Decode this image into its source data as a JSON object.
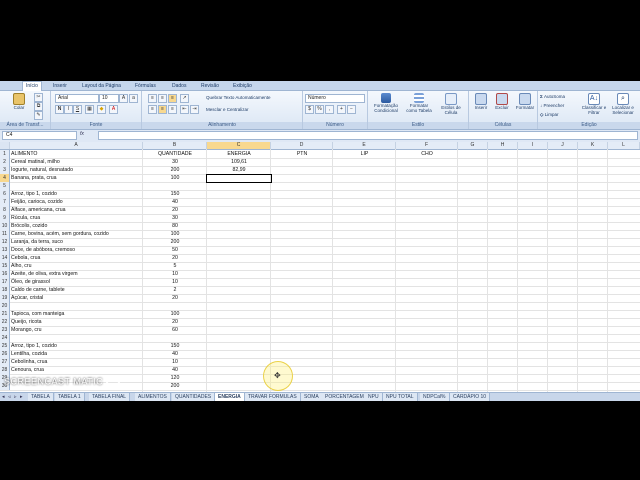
{
  "ribbon_tabs": [
    "Início",
    "Inserir",
    "Layout da Página",
    "Fórmulas",
    "Dados",
    "Revisão",
    "Exibição"
  ],
  "ribbon": {
    "paste_label": "Colar",
    "font_name": "Arial",
    "font_size": "10",
    "wrap_text": "Quebrar Texto Automaticamente",
    "merge_center": "Mesclar e Centralizar",
    "number_format": "Número",
    "cond_format": "Formatação Condicional",
    "format_table": "Formatar como Tabela",
    "cell_styles": "Estilos de Célula",
    "insert": "Inserir",
    "delete": "Excluir",
    "format": "Formatar",
    "autosum": "AutoSoma",
    "fill": "Preencher",
    "clear": "Limpar",
    "sort_filter": "Classificar e Filtrar",
    "find_select": "Localizar e Selecionar",
    "groups": [
      "Área de Transf...",
      "Fonte",
      "Alinhamento",
      "Número",
      "Estilo",
      "Células",
      "Edição"
    ]
  },
  "formula_bar": {
    "name_box": "C4",
    "fx": "fx",
    "content": ""
  },
  "columns": [
    "A",
    "B",
    "C",
    "D",
    "E",
    "F",
    "G",
    "H",
    "I",
    "J",
    "K",
    "L"
  ],
  "rows": [
    {
      "n": "1",
      "a": "ALIMENTO",
      "b": "QUANTIDADE",
      "c": "ENERGIA",
      "d": "PTN",
      "e": "LIP",
      "f": "CHO"
    },
    {
      "n": "2",
      "a": "Cereal matinal, milho",
      "b": "30",
      "c": "109,61",
      "d": "",
      "e": "",
      "f": ""
    },
    {
      "n": "3",
      "a": "Iogurte, natural, desnatado",
      "b": "200",
      "c": "82,99",
      "d": "",
      "e": "",
      "f": ""
    },
    {
      "n": "4",
      "a": "Banana, prata, crua",
      "b": "100",
      "c": "",
      "d": "",
      "e": "",
      "f": ""
    },
    {
      "n": "5",
      "a": "",
      "b": "",
      "c": "",
      "d": "",
      "e": "",
      "f": ""
    },
    {
      "n": "6",
      "a": "Arroz, tipo 1, cozido",
      "b": "150",
      "c": "",
      "d": "",
      "e": "",
      "f": ""
    },
    {
      "n": "7",
      "a": "Feijão, carioca, cozido",
      "b": "40",
      "c": "",
      "d": "",
      "e": "",
      "f": ""
    },
    {
      "n": "8",
      "a": "Alface, americana, crua",
      "b": "20",
      "c": "",
      "d": "",
      "e": "",
      "f": ""
    },
    {
      "n": "9",
      "a": "Rúcula, crua",
      "b": "30",
      "c": "",
      "d": "",
      "e": "",
      "f": ""
    },
    {
      "n": "10",
      "a": "Brócolis, cozido",
      "b": "80",
      "c": "",
      "d": "",
      "e": "",
      "f": ""
    },
    {
      "n": "11",
      "a": "Carne, bovina, acém, sem gordura, cozido",
      "b": "100",
      "c": "",
      "d": "",
      "e": "",
      "f": ""
    },
    {
      "n": "12",
      "a": "Laranja, da terra, suco",
      "b": "200",
      "c": "",
      "d": "",
      "e": "",
      "f": ""
    },
    {
      "n": "13",
      "a": "Doce, de abóbora, cremoso",
      "b": "50",
      "c": "",
      "d": "",
      "e": "",
      "f": ""
    },
    {
      "n": "14",
      "a": "Cebola, crua",
      "b": "20",
      "c": "",
      "d": "",
      "e": "",
      "f": ""
    },
    {
      "n": "15",
      "a": "Alho, cru",
      "b": "5",
      "c": "",
      "d": "",
      "e": "",
      "f": ""
    },
    {
      "n": "16",
      "a": "Azeite, de oliva, extra virgem",
      "b": "10",
      "c": "",
      "d": "",
      "e": "",
      "f": ""
    },
    {
      "n": "17",
      "a": "Óleo, de girassol",
      "b": "10",
      "c": "",
      "d": "",
      "e": "",
      "f": ""
    },
    {
      "n": "18",
      "a": "Caldo de carne, tablete",
      "b": "2",
      "c": "",
      "d": "",
      "e": "",
      "f": ""
    },
    {
      "n": "19",
      "a": "Açúcar, cristal",
      "b": "20",
      "c": "",
      "d": "",
      "e": "",
      "f": ""
    },
    {
      "n": "20",
      "a": "",
      "b": "",
      "c": "",
      "d": "",
      "e": "",
      "f": ""
    },
    {
      "n": "21",
      "a": "Tapioca, com manteiga",
      "b": "100",
      "c": "",
      "d": "",
      "e": "",
      "f": ""
    },
    {
      "n": "22",
      "a": "Queijo, ricota",
      "b": "20",
      "c": "",
      "d": "",
      "e": "",
      "f": ""
    },
    {
      "n": "23",
      "a": "Morango, cru",
      "b": "60",
      "c": "",
      "d": "",
      "e": "",
      "f": ""
    },
    {
      "n": "24",
      "a": "",
      "b": "",
      "c": "",
      "d": "",
      "e": "",
      "f": ""
    },
    {
      "n": "25",
      "a": "Arroz, tipo 1, cozido",
      "b": "150",
      "c": "",
      "d": "",
      "e": "",
      "f": ""
    },
    {
      "n": "26",
      "a": "Lentilha, cozida",
      "b": "40",
      "c": "",
      "d": "",
      "e": "",
      "f": ""
    },
    {
      "n": "27",
      "a": "Cebolinha, crua",
      "b": "10",
      "c": "",
      "d": "",
      "e": "",
      "f": ""
    },
    {
      "n": "28",
      "a": "Cenoura, crua",
      "b": "40",
      "c": "",
      "d": "",
      "e": "",
      "f": ""
    },
    {
      "n": "29",
      "a": "",
      "b": "120",
      "c": "",
      "d": "",
      "e": "",
      "f": ""
    },
    {
      "n": "30",
      "a": "",
      "b": "200",
      "c": "",
      "d": "",
      "e": "",
      "f": ""
    }
  ],
  "sheet_tabs": [
    "TABELA",
    "TABELA 1",
    "TABELA FINAL",
    "ALIMENTOS",
    "QUANTIDADES",
    "ENERGIA",
    "TRAVAR FORMULAS",
    "SOMA",
    "PORCENTAGEM",
    "NPU",
    "NPU TOTAL",
    "NDPCal%",
    "CARDÁPIO 10"
  ],
  "active_sheet": "ENERGIA",
  "watermark": "SCREENCAST MATIC",
  "colors": {
    "ribbon_bg": "#dbe6f4",
    "selected_header": "#f8d88f",
    "sheet_active": "#ffffff"
  }
}
